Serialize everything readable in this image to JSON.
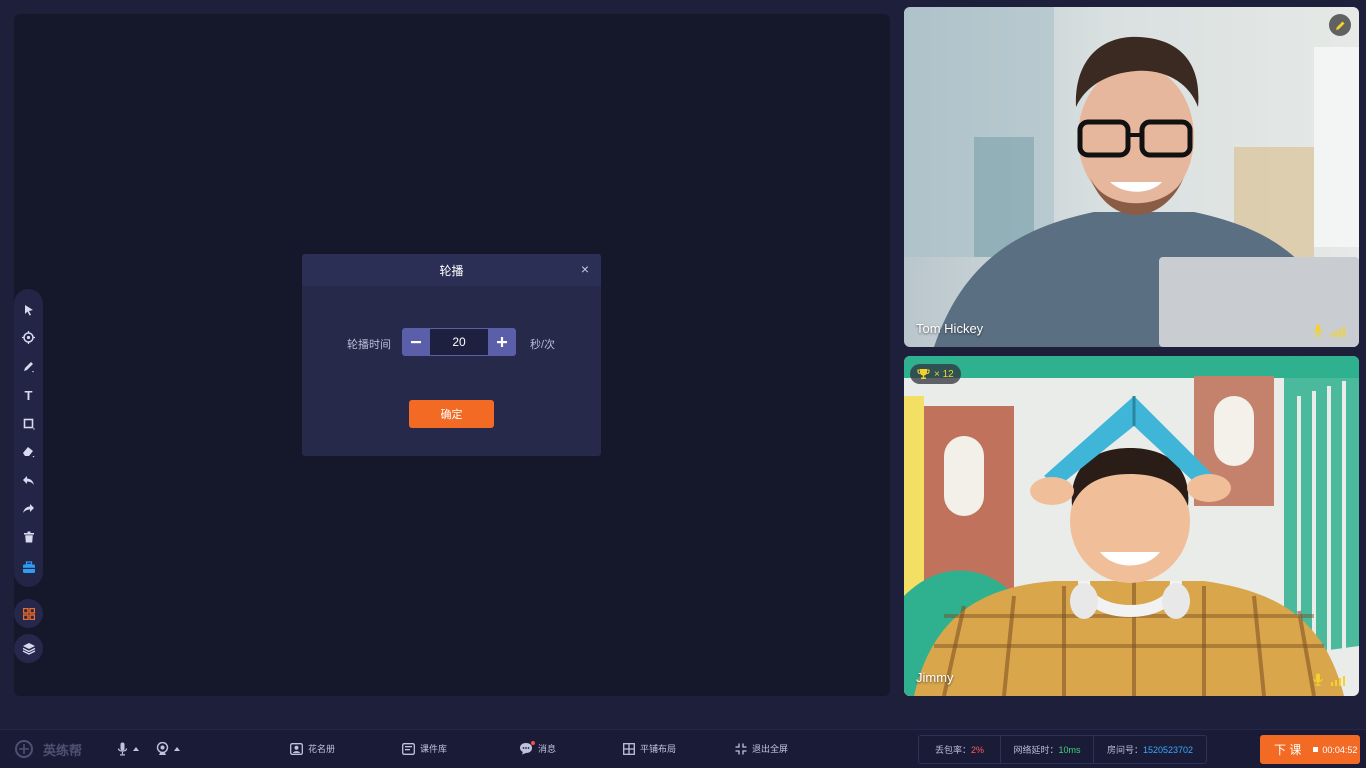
{
  "modal": {
    "title": "轮播",
    "close": "×",
    "label": "轮播时间",
    "value": "20",
    "unit": "秒/次",
    "confirm": "确定"
  },
  "videos": [
    {
      "name": "Tom Hickey",
      "badge_icon": "pencil-icon"
    },
    {
      "name": "Jimmy",
      "trophy_count": "× 12"
    }
  ],
  "toolbar": {
    "tools": [
      "pointer-icon",
      "laser-icon",
      "pen-icon",
      "text-icon",
      "shape-icon",
      "eraser-icon",
      "undo-icon",
      "redo-icon",
      "trash-icon",
      "toolbox-icon"
    ],
    "text_tool_glyph": "T"
  },
  "bottombar": {
    "logo": "英练帮",
    "items": [
      "花名册",
      "课件库",
      "消息",
      "平铺布局",
      "退出全屏"
    ],
    "stats": {
      "loss_label": "丢包率：",
      "loss_value": "2%",
      "latency_label": "网络延时：",
      "latency_value": "10ms",
      "room_label": "房间号：",
      "room_value": "1520523702"
    },
    "end_label": "下 课",
    "timer": "00:04:52"
  },
  "colors": {
    "accent": "#f26a24",
    "stepper": "#5b5ea8",
    "signal": "#f5d22b",
    "loss": "#ff5a5a",
    "latency": "#3ed17a",
    "room": "#3aa7ff"
  }
}
